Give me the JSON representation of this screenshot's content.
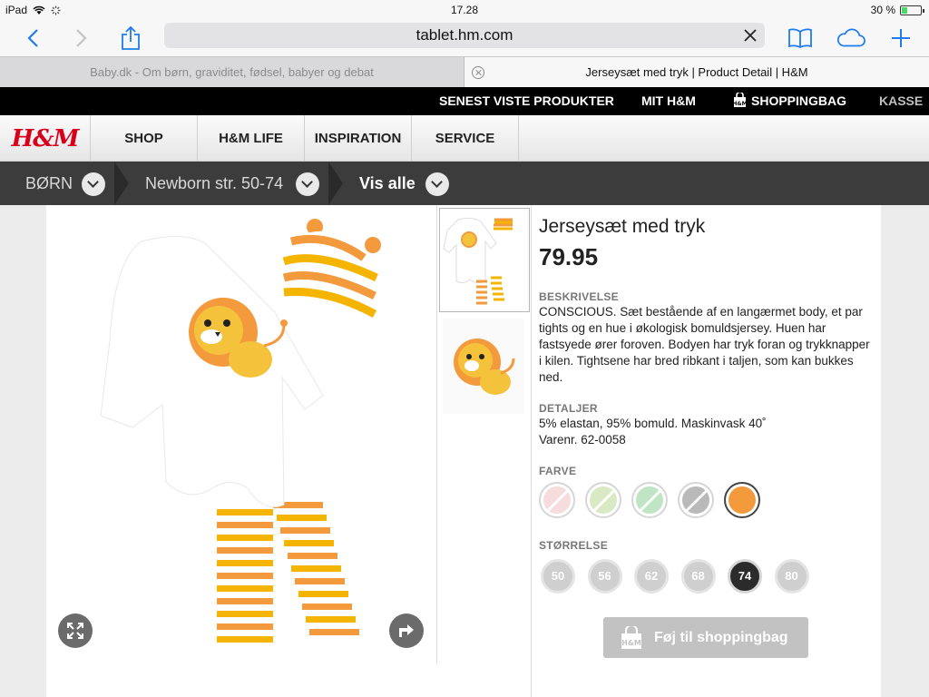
{
  "status_bar": {
    "device": "iPad",
    "time": "17.28",
    "battery": "30 %",
    "battery_level": 0.3
  },
  "browser": {
    "url": "tablet.hm.com",
    "tabs": [
      {
        "label": "Baby.dk - Om børn, graviditet, fødsel, babyer og debat",
        "active": false
      },
      {
        "label": "Jerseysæt med tryk | Product Detail | H&M",
        "active": true
      }
    ]
  },
  "top_links": {
    "recent": "SENEST VISTE PRODUKTER",
    "my_hm": "MIT H&M",
    "bag": "SHOPPINGBAG",
    "checkout": "KASSE"
  },
  "logo": "H&M",
  "main_nav": [
    "SHOP",
    "H&M LIFE",
    "INSPIRATION",
    "SERVICE"
  ],
  "breadcrumbs": [
    "BØRN",
    "Newborn str. 50-74",
    "Vis alle"
  ],
  "product": {
    "title": "Jerseysæt med tryk",
    "price": "79.95",
    "description_label": "BESKRIVELSE",
    "description": "CONSCIOUS. Sæt bestående af en langærmet body, et par tights og en hue i økologisk bomuldsjersey. Huen har fastsyede ører foroven. Bodyen har tryk foran og trykknapper i kilen. Tightsene har bred ribkant i taljen, som kan bukkes ned.",
    "details_label": "DETALJER",
    "details_line1": "5% elastan, 95% bomuld. Maskinvask 40˚",
    "details_line2": "Varenr. 62-0058",
    "color_label": "FARVE",
    "colors": [
      {
        "color": "#f6dcdc",
        "available": false
      },
      {
        "color": "#d9e9c4",
        "available": false
      },
      {
        "color": "#bfe5c4",
        "available": false
      },
      {
        "color": "#b9b9b9",
        "available": false
      },
      {
        "color": "#f39a3c",
        "available": true,
        "selected": true
      }
    ],
    "size_label": "STØRRELSE",
    "sizes": [
      "50",
      "56",
      "62",
      "68",
      "74",
      "80"
    ],
    "selected_size": "74",
    "add_to_bag": "Føj til shoppingbag"
  }
}
